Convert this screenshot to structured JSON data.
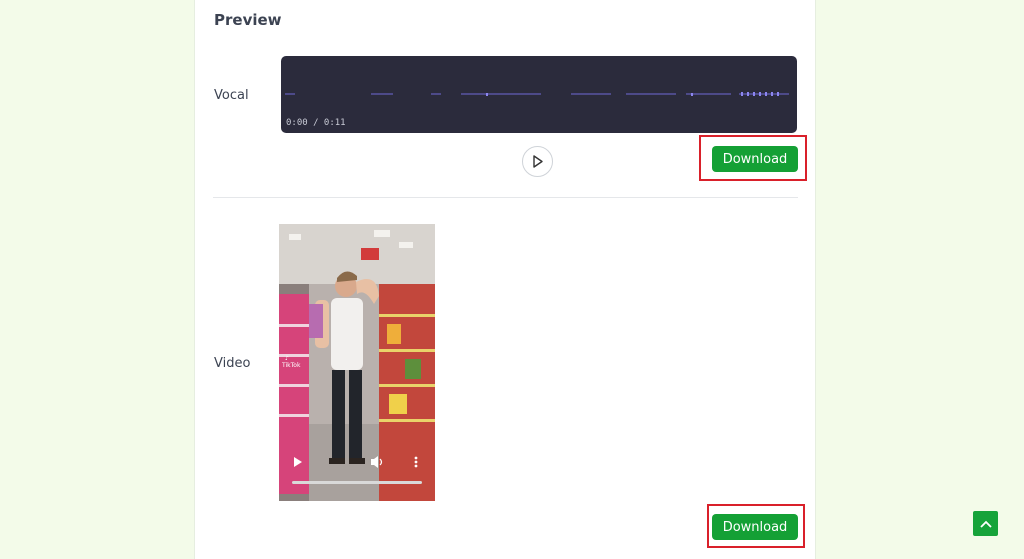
{
  "preview": {
    "title": "Preview"
  },
  "vocal": {
    "label": "Vocal",
    "time": "0:00 / 0:11",
    "play_icon": "play-icon",
    "download_label": "Download"
  },
  "video": {
    "label": "Video",
    "watermark": "TikTok",
    "download_label": "Download"
  },
  "colors": {
    "accent": "#14a035",
    "highlight": "#d9202a",
    "background": "#f3fbe9"
  }
}
